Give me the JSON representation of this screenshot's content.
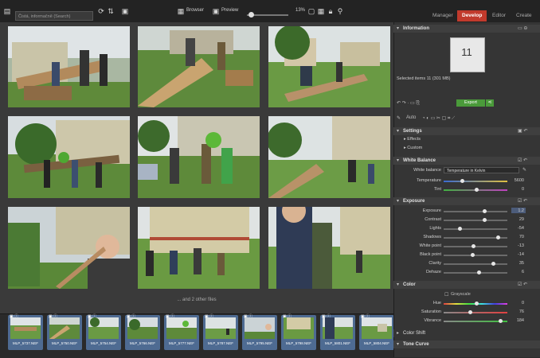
{
  "topbar": {
    "search_placeholder": "Čistá, informačně (Search)",
    "browser_label": "Browser",
    "preview_label": "Preview",
    "zoom": "13%",
    "modes": [
      "Manager",
      "Develop",
      "Editor",
      "Create"
    ],
    "active_mode": "Develop"
  },
  "grid": {
    "more_files": "... and 2 other files"
  },
  "filmstrip": {
    "files": [
      "MLP_5737.NEF",
      "MLP_5750.NEF",
      "MLP_5754.NEF",
      "MLP_5766.NEF",
      "MLP_5777.NEF",
      "MLP_5787.NEF",
      "MLP_5795.NEF",
      "MLP_5798.NEF",
      "MLP_5801.NEF",
      "MLP_5804.NEF"
    ]
  },
  "panel": {
    "information": {
      "title": "Information",
      "count": "11",
      "selected": "Selected items 11 (301 MB)"
    },
    "export_label": "Export",
    "auto_label": "Auto",
    "settings": {
      "title": "Settings",
      "items": [
        "Effects",
        "Custom"
      ]
    },
    "white_balance": {
      "title": "White Balance",
      "wb_label": "White balance",
      "wb_value": "Temperature in Kelvin",
      "rows": [
        {
          "label": "Temperature",
          "value": "5600"
        },
        {
          "label": "Tint",
          "value": "0"
        }
      ]
    },
    "exposure": {
      "title": "Exposure",
      "rows": [
        {
          "label": "Exposure",
          "value": "1.2"
        },
        {
          "label": "Contrast",
          "value": "29"
        },
        {
          "label": "Lights",
          "value": "-54"
        },
        {
          "label": "Shadows",
          "value": "70"
        },
        {
          "label": "White point",
          "value": "-13"
        },
        {
          "label": "Black point",
          "value": "-14"
        },
        {
          "label": "Clarity",
          "value": "35"
        },
        {
          "label": "Dehaze",
          "value": "6"
        }
      ]
    },
    "color": {
      "title": "Color",
      "grayscale_label": "Grayscale",
      "rows": [
        {
          "label": "Hue",
          "value": "0"
        },
        {
          "label": "Saturation",
          "value": "76"
        },
        {
          "label": "Vibrance",
          "value": "184"
        }
      ]
    },
    "color_shift": "Color Shift",
    "tone_curve": "Tone Curve"
  }
}
